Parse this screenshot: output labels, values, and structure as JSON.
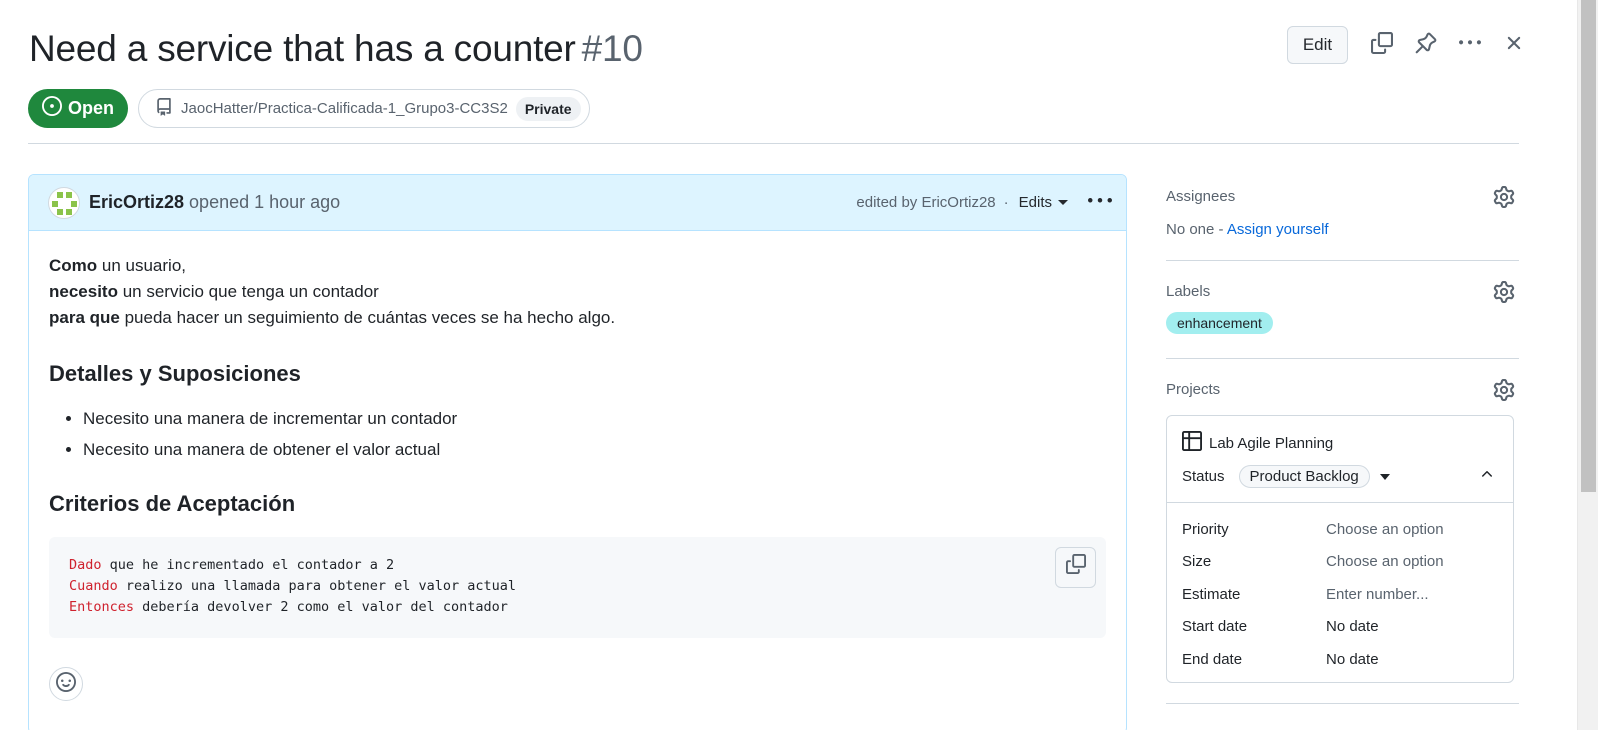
{
  "issue": {
    "title": "Need a service that has a counter",
    "number": "#10",
    "state": "Open",
    "repo": "JaocHatter/Practica-Calificada-1_Grupo3-CC3S2",
    "visibility": "Private"
  },
  "header_actions": {
    "edit_label": "Edit",
    "icons": [
      "copy-icon",
      "pin-icon",
      "kebab-horizontal-icon",
      "close-icon"
    ]
  },
  "comment": {
    "author": "EricOrtiz28",
    "opened_text": "opened 1 hour ago",
    "edited_text": "edited by EricOrtiz28",
    "separator": "·",
    "edits_label": "Edits",
    "body": {
      "line1_bold": "Como",
      "line1_rest": " un usuario,",
      "line2_bold": "necesito",
      "line2_rest": " un servicio que tenga un contador",
      "line3_bold": "para que",
      "line3_rest": " pueda hacer un seguimiento de cuántas veces se ha hecho algo.",
      "heading1": "Detalles y Suposiciones",
      "bullets": [
        "Necesito una manera de incrementar un contador",
        "Necesito una manera de obtener el valor actual"
      ],
      "heading2": "Criterios de Aceptación",
      "code_lines": [
        {
          "kw": "Dado",
          "rest": " que he incrementado el contador a 2"
        },
        {
          "kw": "Cuando",
          "rest": " realizo una llamada para obtener el valor actual"
        },
        {
          "kw": "Entonces",
          "rest": " debería devolver 2 como el valor del contador"
        }
      ]
    }
  },
  "sidebar": {
    "assignees": {
      "heading": "Assignees",
      "none_text": "No one - ",
      "assign_link": "Assign yourself"
    },
    "labels": {
      "heading": "Labels",
      "items": [
        {
          "name": "enhancement",
          "color": "#a2eeef"
        }
      ]
    },
    "projects": {
      "heading": "Projects",
      "project_name": "Lab Agile Planning",
      "status_label": "Status",
      "status_value": "Product Backlog",
      "fields": [
        {
          "label": "Priority",
          "value": "Choose an option"
        },
        {
          "label": "Size",
          "value": "Choose an option"
        },
        {
          "label": "Estimate",
          "value": "Enter number..."
        },
        {
          "label": "Start date",
          "value": "No date"
        },
        {
          "label": "End date",
          "value": "No date"
        }
      ]
    }
  },
  "colors": {
    "open_green": "#1f883d",
    "link_blue": "#0969da",
    "comment_header_bg": "#ddf4ff",
    "keyword_red": "#cf222e"
  }
}
